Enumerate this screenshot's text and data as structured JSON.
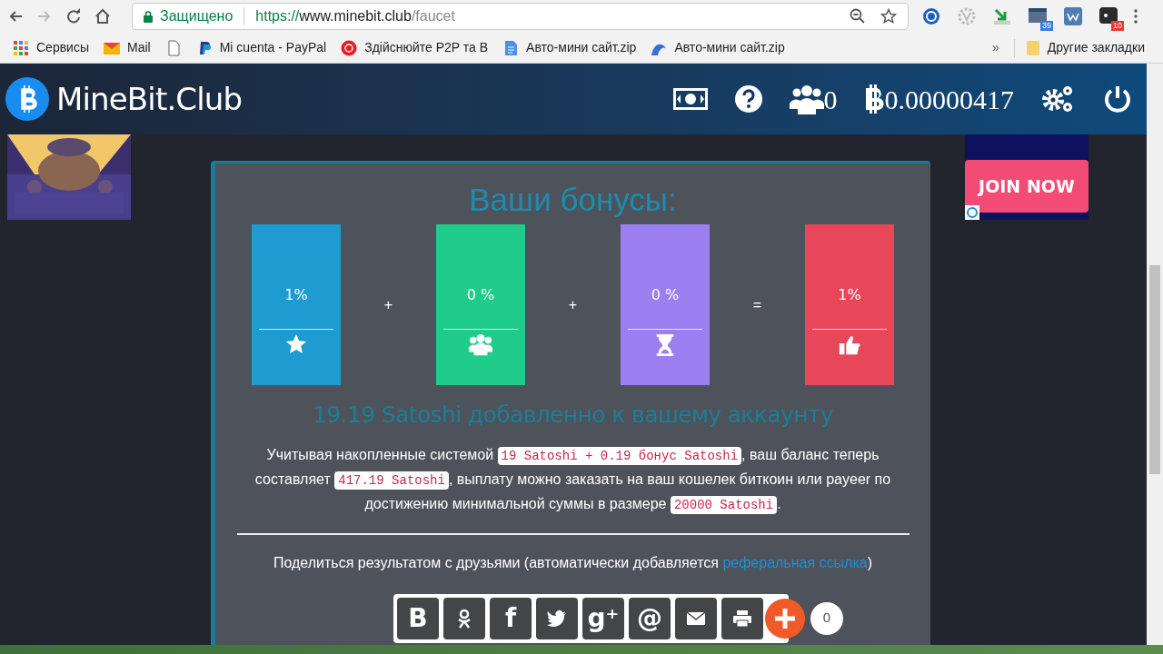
{
  "browser": {
    "nav": [
      {
        "kind": "back",
        "disabled": false
      },
      {
        "kind": "forward",
        "disabled": true
      },
      {
        "kind": "reload",
        "disabled": false
      },
      {
        "kind": "home",
        "disabled": false
      }
    ],
    "security": "Защищено",
    "url": {
      "scheme": "https://",
      "host": "www.minebit.club",
      "path": "/faucet"
    },
    "extensions": [
      {
        "kind": "circle"
      },
      {
        "kind": "gear"
      },
      {
        "kind": "download"
      },
      {
        "kind": "window",
        "badge": "39"
      },
      {
        "kind": "square"
      },
      {
        "kind": "dark",
        "badge": "10"
      }
    ],
    "bookmarks": [
      {
        "kind": "apps",
        "label": "Сервисы"
      },
      {
        "kind": "mail",
        "label": "Mail"
      },
      {
        "kind": "page"
      },
      {
        "kind": "paypal",
        "label": "Mi cuenta - PayPal"
      },
      {
        "kind": "pm",
        "label": "Здійснюйте P2P та В"
      },
      {
        "kind": "doc",
        "label": "Авто-мини сайт.zip"
      },
      {
        "kind": "cloud",
        "label": "Авто-мини сайт.zip"
      }
    ],
    "overflow": "»",
    "other_bookmarks": "Другие закладки"
  },
  "site": {
    "logo": "MineBit.Club",
    "referrals": "0",
    "balance": "0.00000417"
  },
  "ads": {
    "right_button": "JOIN NOW"
  },
  "bonuses": {
    "title": "Ваши бонусы:",
    "tiles": [
      {
        "percent": "1%",
        "kind": "star",
        "color": "#1e9bd0"
      },
      {
        "percent": "0 %",
        "kind": "users",
        "color": "#1fcc8a"
      },
      {
        "percent": "0 %",
        "kind": "hourglass",
        "color": "#9b7ff0"
      },
      {
        "percent": "1%",
        "kind": "thumb",
        "color": "#e8475a"
      }
    ],
    "operators": [
      "+",
      "+",
      "="
    ],
    "added": "19.19 Satoshi добавленно к вашему аккаунту",
    "message": [
      {
        "kind": "text",
        "text": "Учитывая накопленные системой "
      },
      {
        "kind": "code",
        "text": "19 Satoshi + 0.19 бонус Satoshi"
      },
      {
        "kind": "text",
        "text": ", ваш баланс теперь составляет "
      },
      {
        "kind": "code",
        "text": "417.19 Satoshi"
      },
      {
        "kind": "text",
        "text": ", выплату можно заказать на ваш кошелек биткоин или payeer по достижению минимальной суммы в размере "
      },
      {
        "kind": "code",
        "text": "20000 Satoshi"
      },
      {
        "kind": "text",
        "text": "."
      }
    ],
    "share_text": "Поделиться результатом с друзьями (автоматически добавляется ",
    "share_link": "реферальная ссылка",
    "share_end": ")",
    "share": [
      {
        "glyph": "В"
      },
      {
        "kind": "ok"
      },
      {
        "glyph": "f"
      },
      {
        "kind": "twitter"
      },
      {
        "glyph": "g⁺"
      },
      {
        "glyph": "@"
      },
      {
        "kind": "mail"
      },
      {
        "kind": "print"
      }
    ],
    "share_count": "0"
  }
}
